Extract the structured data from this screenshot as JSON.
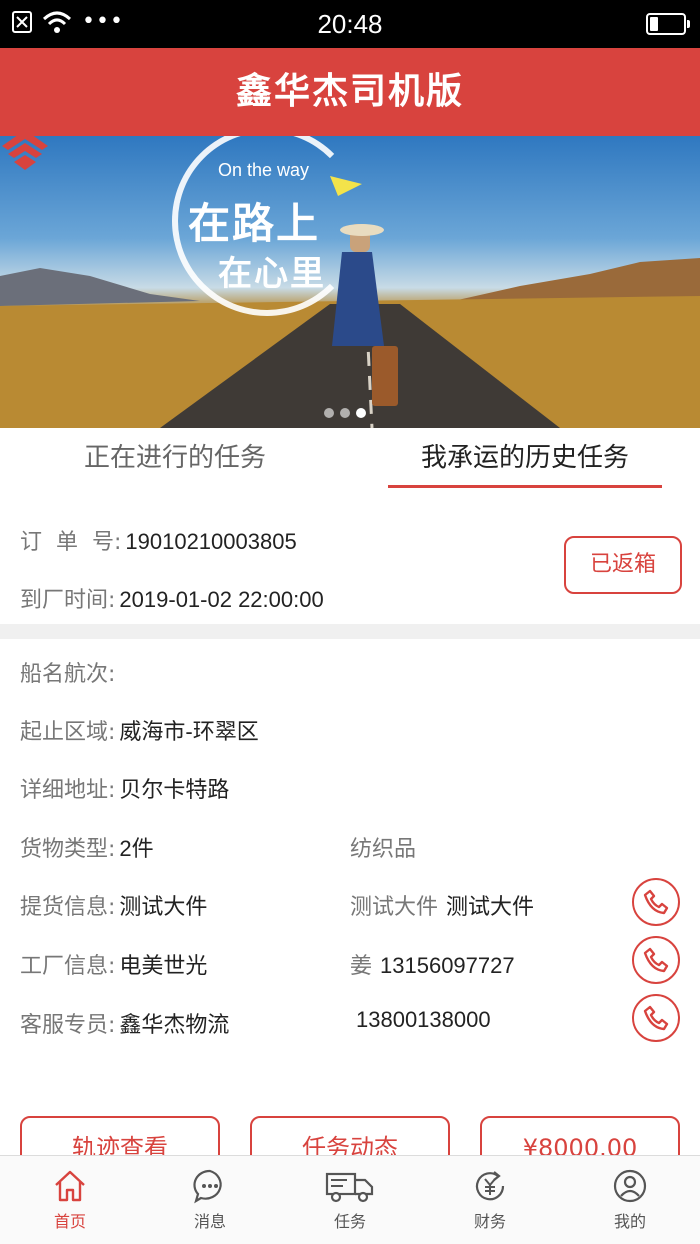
{
  "status_bar": {
    "time": "20:48",
    "icons": [
      "close-box-icon",
      "wifi-icon",
      "more-dots-icon",
      "battery-icon"
    ],
    "dots": "•••"
  },
  "header": {
    "title": "鑫华杰司机版"
  },
  "banner": {
    "text_en": "On the way",
    "text_line1": "在路上",
    "text_line2": "在心里",
    "slide_count": 3,
    "active_slide": 3
  },
  "tabs": [
    {
      "label": "正在进行的任务",
      "active": false
    },
    {
      "label": "我承运的历史任务",
      "active": true
    }
  ],
  "order": {
    "order_no_label": "订  单  号:",
    "order_no": "19010210003805",
    "arrival_label": "到厂时间:",
    "arrival_time": "2019-01-02 22:00:00",
    "status": "已返箱"
  },
  "details": {
    "ship_label": "船名航次:",
    "ship_value": "",
    "region_label": "起止区域:",
    "region_value": "威海市-环翠区",
    "address_label": "详细地址:",
    "address_value": "贝尔卡特路",
    "cargo_label": "货物类型:",
    "cargo_value": "2件",
    "cargo_type": "纺织品",
    "pickup_label": "提货信息:",
    "pickup_value": "测试大件",
    "pickup_contact_label": "测试大件",
    "pickup_contact_value": "测试大件",
    "factory_label": "工厂信息:",
    "factory_value": "电美世光",
    "factory_contact_label": "姜",
    "factory_contact_value": "13156097727",
    "service_label": "客服专员:",
    "service_value": "鑫华杰物流",
    "service_phone": "13800138000"
  },
  "actions": {
    "track_label": "轨迹查看",
    "task_status_label": "任务动态",
    "price_label": "¥8000.00"
  },
  "bottom_nav": [
    {
      "label": "首页",
      "icon": "home-icon",
      "active": true
    },
    {
      "label": "消息",
      "icon": "message-icon",
      "active": false
    },
    {
      "label": "任务",
      "icon": "truck-icon",
      "active": false
    },
    {
      "label": "财务",
      "icon": "finance-icon",
      "active": false
    },
    {
      "label": "我的",
      "icon": "profile-icon",
      "active": false
    }
  ],
  "colors": {
    "brand": "#d8433e",
    "statusbar": "#000000",
    "divider": "#f0f0f0"
  }
}
